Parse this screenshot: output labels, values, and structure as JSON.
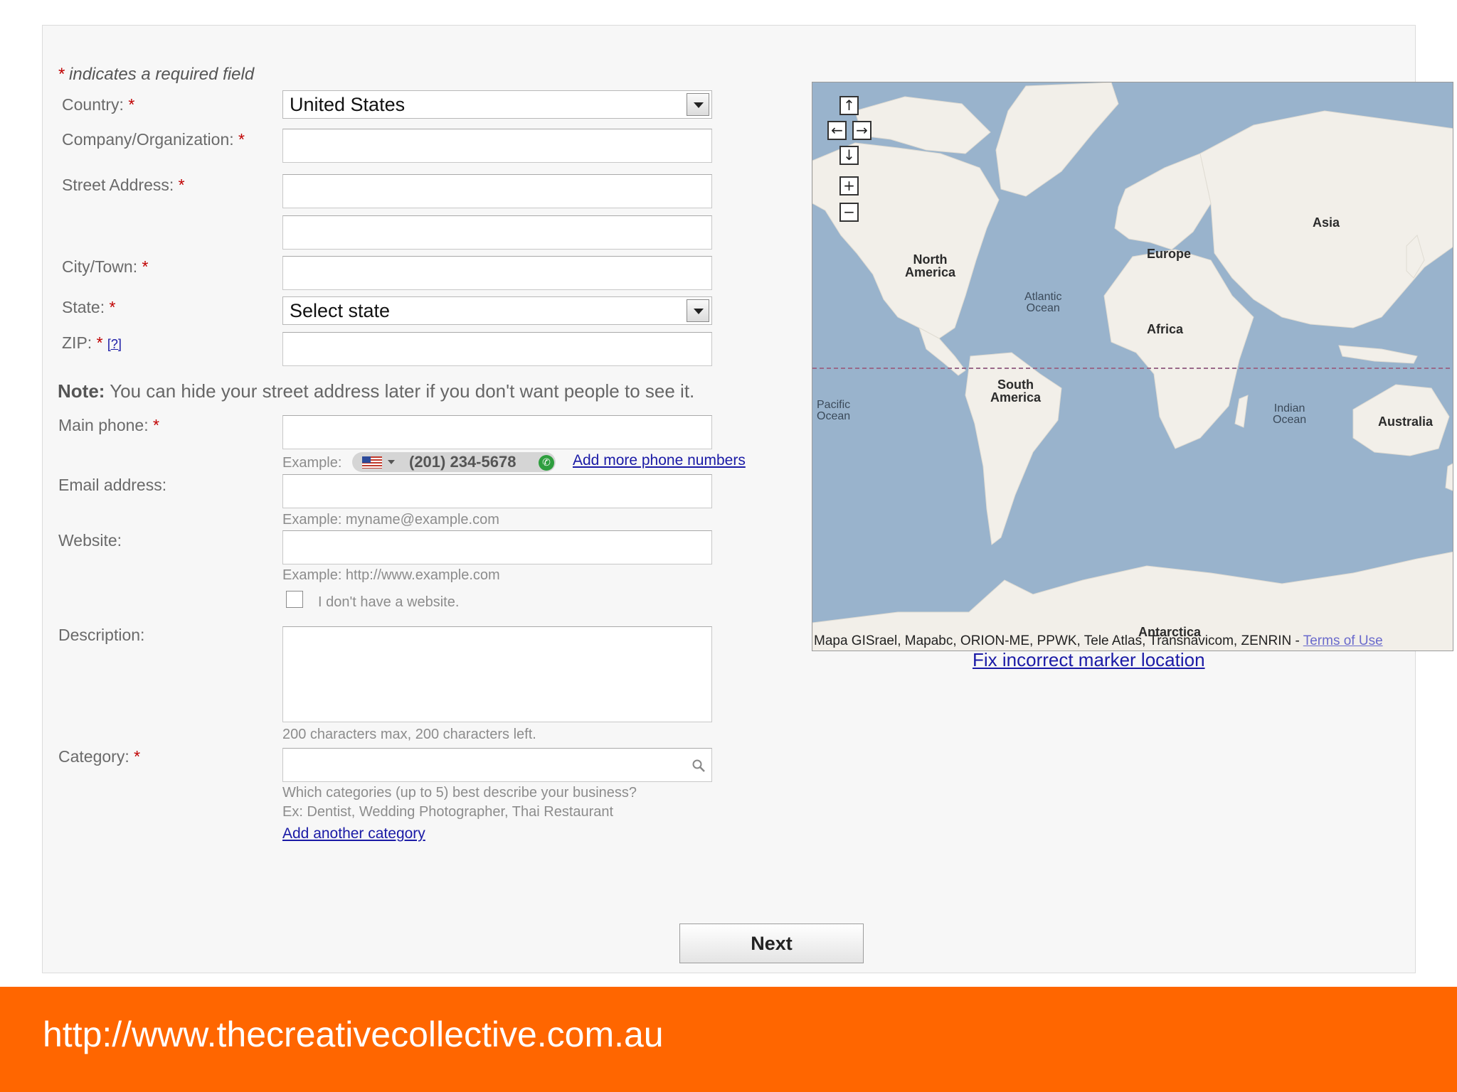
{
  "form": {
    "required_note": "indicates a required field",
    "asterisk": "*",
    "country_label": "Country:",
    "country_value": "United States",
    "company_label": "Company/Organization:",
    "street_label": "Street Address:",
    "city_label": "City/Town:",
    "state_label": "State:",
    "state_value": "Select state",
    "zip_label": "ZIP:",
    "zip_help": "[?]",
    "note_bold": "Note:",
    "note_text": " You can hide your street address later if you don't want people to see it.",
    "phone_label": "Main phone:",
    "phone_example_label": "Example:",
    "phone_example_number": "(201) 234-5678",
    "add_phone_link": "Add more phone numbers",
    "email_label": "Email address:",
    "email_example": "Example: myname@example.com",
    "website_label": "Website:",
    "website_example": "Example: http://www.example.com",
    "no_website_label": "I don't have a website.",
    "description_label": "Description:",
    "description_counter": "200 characters max, 200 characters left.",
    "category_label": "Category:",
    "category_hint_1": "Which categories (up to 5) best describe your business?",
    "category_hint_2": "Ex: Dentist, Wedding Photographer, Thai Restaurant",
    "add_category_link": "Add another category",
    "next_button": "Next"
  },
  "map": {
    "labels": {
      "north_america": "North\nAmerica",
      "south_america": "South\nAmerica",
      "europe": "Europe",
      "asia": "Asia",
      "africa": "Africa",
      "australia": "Australia",
      "antarctica": "Antarctica",
      "atlantic": "Atlantic\nOcean",
      "pacific": "Pacific\nOcean",
      "indian": "Indian\nOcean"
    },
    "copyright": "Mapa GISrael, Mapabc, ORION-ME, PPWK, Tele Atlas, Transnavicom, ZENRIN - ",
    "terms_link": "Terms of Use",
    "fix_marker_link": "Fix incorrect marker location",
    "colors": {
      "water": "#99b3cc",
      "land": "#f2efe9"
    }
  },
  "footer": {
    "url": "http://www.thecreativecollective.com.au",
    "color": "#ff6600"
  }
}
